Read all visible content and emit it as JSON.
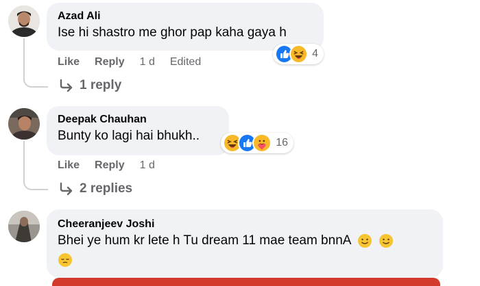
{
  "comments": [
    {
      "author": "Azad Ali",
      "text": "Ise hi shastro me ghor pap kaha gaya h",
      "actions": {
        "like": "Like",
        "reply": "Reply",
        "time": "1 d",
        "edited": "Edited"
      },
      "reactions": {
        "icons": [
          "like-icon",
          "haha-icon"
        ],
        "count": "4"
      },
      "replies_label": "1 reply"
    },
    {
      "author": "Deepak Chauhan",
      "text": "Bunty ko lagi hai bhukh..",
      "actions": {
        "like": "Like",
        "reply": "Reply",
        "time": "1 d"
      },
      "reactions": {
        "icons": [
          "haha-icon",
          "like-icon",
          "care-icon"
        ],
        "count": "16"
      },
      "replies_label": "2 replies"
    },
    {
      "author": "Cheeranjeev Joshi",
      "text_line1": "Bhei ye hum kr lete h Tu dream 11 mae team bnnA",
      "text_emojis": [
        "smile-emoji",
        "smile-emoji",
        "pensive-emoji"
      ]
    }
  ],
  "colors": {
    "bubble": "#f0f2f5",
    "meta_text": "#65676b",
    "like_blue": "#1877f2",
    "reaction_yellow": "#f7b928",
    "bar_red": "#d33a2b"
  }
}
